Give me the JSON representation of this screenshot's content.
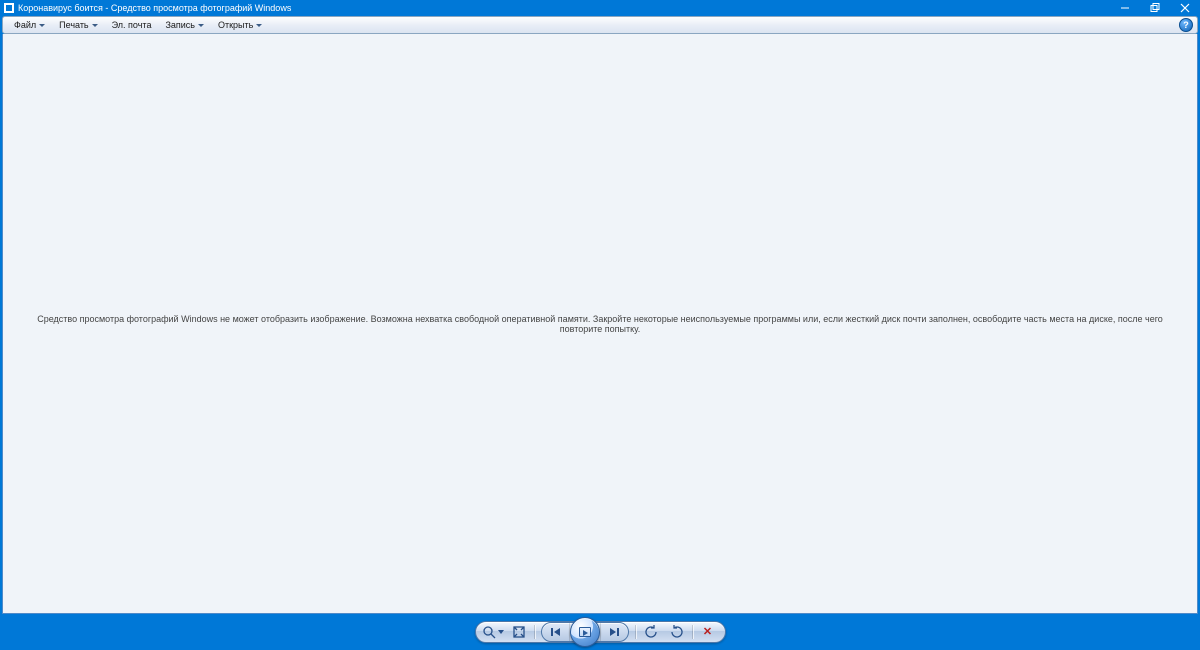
{
  "titlebar": {
    "title": "Коронавирус боится - Средство просмотра фотографий Windows"
  },
  "toolbar": {
    "file": {
      "label": "Файл"
    },
    "print": {
      "label": "Печать"
    },
    "email": {
      "label": "Эл. почта"
    },
    "burn": {
      "label": "Запись"
    },
    "open": {
      "label": "Открыть"
    },
    "help": {
      "label": "?"
    }
  },
  "content": {
    "error_message": "Средство просмотра фотографий Windows не может отобразить изображение. Возможна нехватка свободной оперативной памяти. Закройте некоторые неиспользуемые программы или, если жесткий диск почти заполнен, освободите часть места на диске, после чего повторите попытку."
  },
  "controls": {
    "zoom": "zoom",
    "fit": "actual-size",
    "prev": "previous",
    "slideshow": "slideshow",
    "next": "next",
    "rotate_ccw": "rotate-left",
    "rotate_cw": "rotate-right",
    "delete": "delete"
  },
  "colors": {
    "accent": "#0078d7",
    "canvas": "#f0f4f9"
  }
}
